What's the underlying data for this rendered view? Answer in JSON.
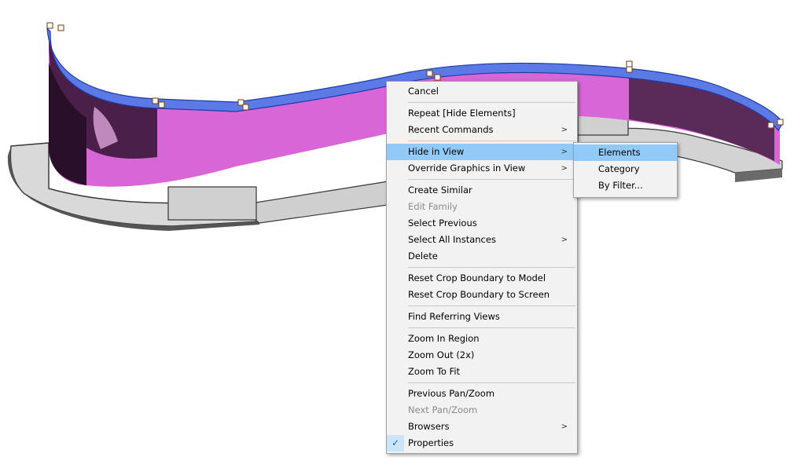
{
  "context_menu": {
    "items": [
      {
        "label": "Cancel"
      },
      {
        "separator": true
      },
      {
        "label": "Repeat [Hide Elements]"
      },
      {
        "label": "Recent Commands",
        "submenu": true
      },
      {
        "separator": true
      },
      {
        "label": "Hide in View",
        "submenu": true,
        "highlighted": true
      },
      {
        "label": "Override Graphics in View",
        "submenu": true
      },
      {
        "separator": true
      },
      {
        "label": "Create Similar"
      },
      {
        "label": "Edit Family",
        "disabled": true
      },
      {
        "label": "Select Previous"
      },
      {
        "label": "Select All Instances",
        "submenu": true
      },
      {
        "label": "Delete"
      },
      {
        "separator": true
      },
      {
        "label": "Reset Crop Boundary to Model"
      },
      {
        "label": "Reset Crop Boundary to Screen"
      },
      {
        "separator": true
      },
      {
        "label": "Find Referring Views"
      },
      {
        "separator": true
      },
      {
        "label": "Zoom In Region"
      },
      {
        "label": "Zoom Out (2x)"
      },
      {
        "label": "Zoom To Fit"
      },
      {
        "separator": true
      },
      {
        "label": "Previous Pan/Zoom"
      },
      {
        "label": "Next Pan/Zoom",
        "disabled": true
      },
      {
        "label": "Browsers",
        "submenu": true
      },
      {
        "label": "Properties",
        "checked": true
      }
    ],
    "arrow_glyph": ">",
    "check_glyph": "✓"
  },
  "submenu_hide_in_view": {
    "items": [
      {
        "label": "Elements",
        "highlighted": true
      },
      {
        "label": "Category"
      },
      {
        "label": "By Filter..."
      }
    ]
  },
  "colors": {
    "wall_face": "#d966d6",
    "wall_dark": "#3a1a3a",
    "wall_top_selected": "#4f6fe0",
    "slab": "#cfcfcf",
    "menu_highlight": "#91c9f7"
  }
}
